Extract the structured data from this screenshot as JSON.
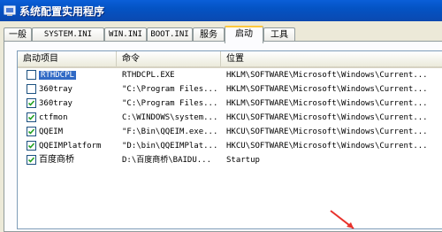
{
  "window": {
    "title": "系统配置实用程序"
  },
  "tabs": [
    {
      "label": "一般",
      "active": false
    },
    {
      "label": "SYSTEM.INI",
      "active": false
    },
    {
      "label": "WIN.INI",
      "active": false
    },
    {
      "label": "BOOT.INI",
      "active": false
    },
    {
      "label": "服务",
      "active": false
    },
    {
      "label": "启动",
      "active": true
    },
    {
      "label": "工具",
      "active": false
    }
  ],
  "columns": {
    "name": "启动项目",
    "command": "命令",
    "location": "位置"
  },
  "rows": [
    {
      "checked": false,
      "selected": true,
      "name": "RTHDCPL",
      "command": "RTHDCPL.EXE",
      "location": "HKLM\\SOFTWARE\\Microsoft\\Windows\\Current..."
    },
    {
      "checked": false,
      "selected": false,
      "name": "360tray",
      "command": "\"C:\\Program Files...",
      "location": "HKLM\\SOFTWARE\\Microsoft\\Windows\\Current..."
    },
    {
      "checked": true,
      "selected": false,
      "name": "360tray",
      "command": "\"C:\\Program Files...",
      "location": "HKLM\\SOFTWARE\\Microsoft\\Windows\\Current..."
    },
    {
      "checked": true,
      "selected": false,
      "name": "ctfmon",
      "command": "C:\\WINDOWS\\system...",
      "location": "HKCU\\SOFTWARE\\Microsoft\\Windows\\Current..."
    },
    {
      "checked": true,
      "selected": false,
      "name": "QQEIM",
      "command": "\"F:\\Bin\\QQEIM.exe...",
      "location": "HKCU\\SOFTWARE\\Microsoft\\Windows\\Current..."
    },
    {
      "checked": true,
      "selected": false,
      "name": "QQEIMPlatform",
      "command": "\"D:\\bin\\QQEIMPlat...",
      "location": "HKCU\\SOFTWARE\\Microsoft\\Windows\\Current..."
    },
    {
      "checked": true,
      "selected": false,
      "name": "百度商桥",
      "command": "D:\\百度商桥\\BAIDU...",
      "location": "Startup"
    }
  ],
  "colors": {
    "accent": "#316ac5",
    "titlebar": "#0a5fd8",
    "arrow": "#e8322c"
  }
}
